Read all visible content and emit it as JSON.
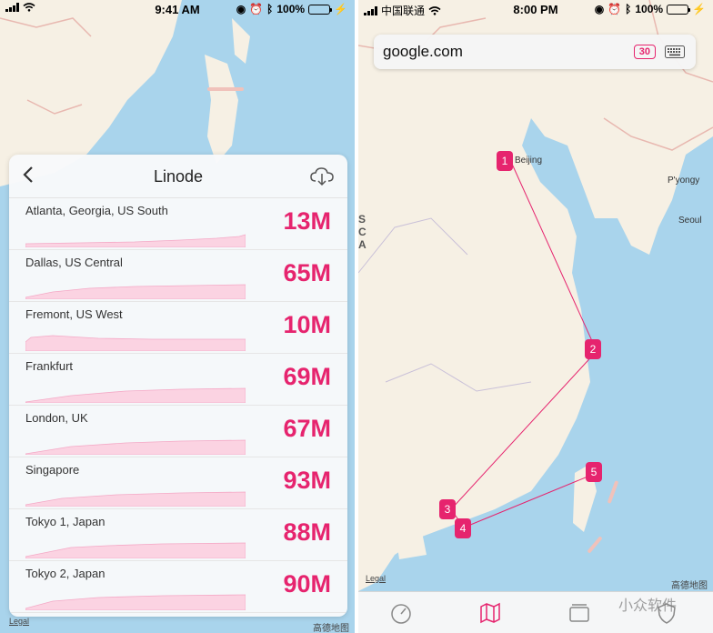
{
  "left": {
    "status": {
      "time": "9:41 AM",
      "battery": "100%"
    },
    "card": {
      "title": "Linode",
      "rows": [
        {
          "name": "Atlanta, Georgia, US South",
          "value": "13M"
        },
        {
          "name": "Dallas, US Central",
          "value": "65M"
        },
        {
          "name": "Fremont, US West",
          "value": "10M"
        },
        {
          "name": "Frankfurt",
          "value": "69M"
        },
        {
          "name": "London, UK",
          "value": "67M"
        },
        {
          "name": "Singapore",
          "value": "93M"
        },
        {
          "name": "Tokyo 1, Japan",
          "value": "88M"
        },
        {
          "name": "Tokyo 2, Japan",
          "value": "90M"
        }
      ]
    },
    "legal": "Legal",
    "map_logo": "高德地图"
  },
  "right": {
    "status": {
      "carrier": "中国联通",
      "time": "8:00 PM",
      "battery": "100%"
    },
    "search": {
      "value": "google.com",
      "count": "30"
    },
    "cities": {
      "beijing": "Beijing",
      "pyongyang": "P'yongy",
      "seoul": "Seoul",
      "ocean": "S\nC\nA"
    },
    "markers": [
      "1",
      "2",
      "3",
      "4",
      "5"
    ],
    "legal": "Legal",
    "map_logo": "高德地图",
    "watermark": "小众软件"
  },
  "colors": {
    "accent": "#e6246e",
    "water": "#a9d4ec",
    "land": "#f6f0e4"
  }
}
